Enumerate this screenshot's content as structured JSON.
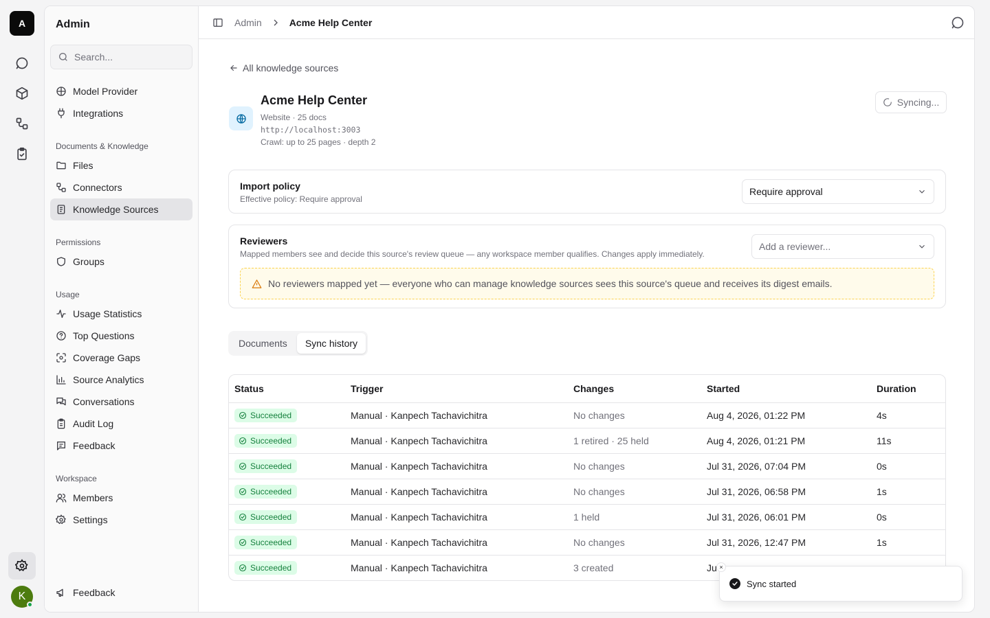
{
  "rail": {
    "logo_letter": "A",
    "avatar_letter": "K",
    "icons": [
      "chat-icon",
      "box-icon",
      "workflow-icon",
      "clipboard-check-icon"
    ]
  },
  "sidebar": {
    "title": "Admin",
    "search_placeholder": "Search...",
    "top_items": [
      {
        "label": "Model Provider",
        "icon": "brain-icon"
      },
      {
        "label": "Integrations",
        "icon": "plug-icon"
      }
    ],
    "groups": [
      {
        "label": "Documents & Knowledge",
        "items": [
          {
            "label": "Files",
            "icon": "folder-icon"
          },
          {
            "label": "Connectors",
            "icon": "workflow-icon"
          },
          {
            "label": "Knowledge Sources",
            "icon": "book-icon",
            "active": true
          }
        ]
      },
      {
        "label": "Permissions",
        "items": [
          {
            "label": "Groups",
            "icon": "shield-icon"
          }
        ]
      },
      {
        "label": "Usage",
        "items": [
          {
            "label": "Usage Statistics",
            "icon": "activity-icon"
          },
          {
            "label": "Top Questions",
            "icon": "help-circle-icon"
          },
          {
            "label": "Coverage Gaps",
            "icon": "scan-icon"
          },
          {
            "label": "Source Analytics",
            "icon": "bar-chart-icon"
          },
          {
            "label": "Conversations",
            "icon": "messages-icon"
          },
          {
            "label": "Audit Log",
            "icon": "clipboard-icon"
          },
          {
            "label": "Feedback",
            "icon": "message-square-text-icon"
          }
        ]
      },
      {
        "label": "Workspace",
        "items": [
          {
            "label": "Members",
            "icon": "users-icon"
          },
          {
            "label": "Settings",
            "icon": "gear-icon"
          }
        ]
      }
    ],
    "footer_feedback": "Feedback"
  },
  "breadcrumb": {
    "parent": "Admin",
    "current": "Acme Help Center"
  },
  "back_link": "All knowledge sources",
  "source": {
    "title": "Acme Help Center",
    "meta": "Website · 25 docs",
    "url": "http://localhost:3003",
    "crawl": "Crawl: up to 25 pages · depth 2",
    "sync_button": "Syncing..."
  },
  "import_policy": {
    "title": "Import policy",
    "subtitle": "Effective policy: Require approval",
    "selected": "Require approval"
  },
  "reviewers": {
    "title": "Reviewers",
    "subtitle": "Mapped members see and decide this source's review queue — any workspace member qualifies. Changes apply immediately.",
    "placeholder": "Add a reviewer...",
    "warning": "No reviewers mapped yet — everyone who can manage knowledge sources sees this source's queue and receives its digest emails."
  },
  "tabs": [
    {
      "label": "Documents",
      "active": false
    },
    {
      "label": "Sync history",
      "active": true
    }
  ],
  "table": {
    "columns": [
      "Status",
      "Trigger",
      "Changes",
      "Started",
      "Duration"
    ],
    "rows": [
      {
        "status": "Succeeded",
        "trigger": "Manual · Kanpech Tachavichitra",
        "changes": "No changes",
        "started": "Aug 4, 2026, 01:22 PM",
        "duration": "4s"
      },
      {
        "status": "Succeeded",
        "trigger": "Manual · Kanpech Tachavichitra",
        "changes": "1 retired · 25 held",
        "started": "Aug 4, 2026, 01:21 PM",
        "duration": "11s"
      },
      {
        "status": "Succeeded",
        "trigger": "Manual · Kanpech Tachavichitra",
        "changes": "No changes",
        "started": "Jul 31, 2026, 07:04 PM",
        "duration": "0s"
      },
      {
        "status": "Succeeded",
        "trigger": "Manual · Kanpech Tachavichitra",
        "changes": "No changes",
        "started": "Jul 31, 2026, 06:58 PM",
        "duration": "1s"
      },
      {
        "status": "Succeeded",
        "trigger": "Manual · Kanpech Tachavichitra",
        "changes": "1 held",
        "started": "Jul 31, 2026, 06:01 PM",
        "duration": "0s"
      },
      {
        "status": "Succeeded",
        "trigger": "Manual · Kanpech Tachavichitra",
        "changes": "No changes",
        "started": "Jul 31, 2026, 12:47 PM",
        "duration": "1s"
      },
      {
        "status": "Succeeded",
        "trigger": "Manual · Kanpech Tachavichitra",
        "changes": "3 created",
        "started": "Ju",
        "duration": ""
      }
    ]
  },
  "toast": {
    "message": "Sync started",
    "close": "×"
  },
  "colors": {
    "success_bg": "#dcfce7",
    "success_fg": "#15803d",
    "warning_border": "#fcd34d",
    "warning_bg": "#fffbeb",
    "active_nav": "#e4e4e7"
  }
}
